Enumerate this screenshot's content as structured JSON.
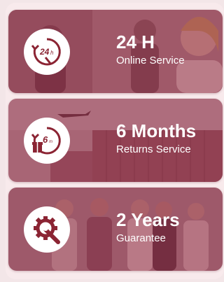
{
  "colors": {
    "icon": "#8b2433",
    "tint": "#8c243c",
    "background": "#f8eaec"
  },
  "cards": [
    {
      "headline": "24 H",
      "subtitle": "Online Service",
      "icon": "24h-clock-icon"
    },
    {
      "headline": "6 Months",
      "subtitle": "Returns Service",
      "icon": "6-clock-gift-icon"
    },
    {
      "headline": "2 Years",
      "subtitle": "Guarantee",
      "icon": "gear-wrench-icon"
    }
  ]
}
